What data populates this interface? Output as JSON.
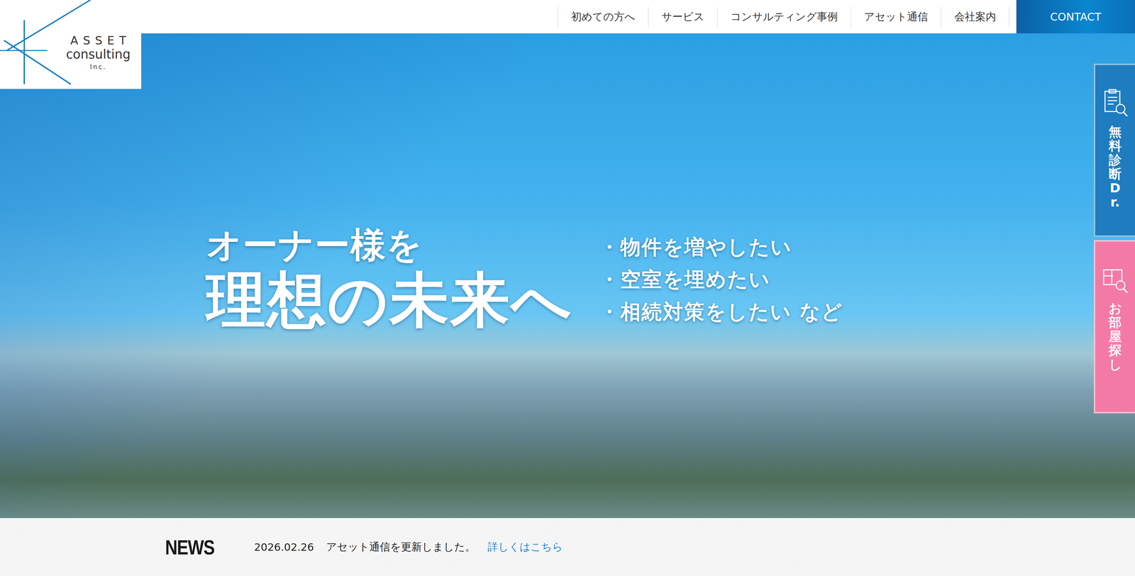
{
  "logo": {
    "line1": "ASSET",
    "line2": "consulting",
    "line3": "Inc."
  },
  "nav": {
    "items": [
      "初めての方へ",
      "サービス",
      "コンサルティング事例",
      "アセット通信",
      "会社案内"
    ],
    "contact": "CONTACT"
  },
  "hero": {
    "heading_small": "オーナー様を",
    "heading_large": "理想の未来へ",
    "bullets": [
      "・物件を増やしたい",
      "・空室を埋めたい",
      "・相続対策をしたい など"
    ]
  },
  "side_tabs": [
    {
      "label": "無料診断Dr.",
      "color": "#1f7cbf"
    },
    {
      "label": "お部屋探し",
      "color": "#f47aa6"
    }
  ],
  "news": {
    "label": "NEWS",
    "items": [
      {
        "date": "2026.02.26",
        "text": "アセット通信を更新しました。",
        "link": "詳しくはこちら"
      }
    ]
  }
}
